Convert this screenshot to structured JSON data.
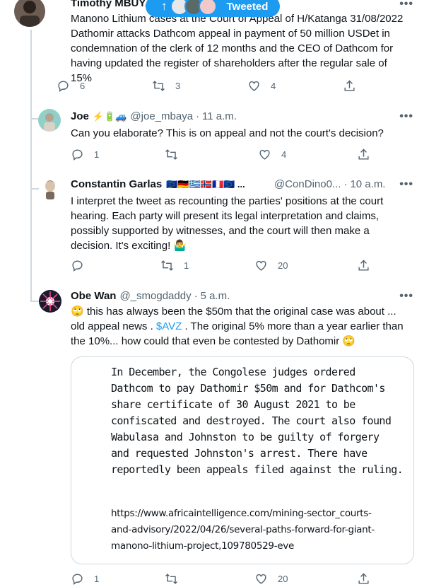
{
  "toast": {
    "label": "Tweeted",
    "arrow": "↑"
  },
  "tweets": [
    {
      "name": "Timothy MBUYA",
      "handle": "@",
      "text": "Manono Lithium cases at the Court of Appeal of H/Katanga 31/08/2022\nDathomir attacks Dathcom appeal in payment of 50 million USDet in\ncondemnation of the clerk of 12 months and the CEO of Dathcom for\nhaving updated the register of shareholders after the regular sale of 15%",
      "replies": "6",
      "retweets": "3",
      "likes": "4"
    },
    {
      "name": "Joe",
      "name_emoji": "⚡🔋🚙",
      "handle": "@joe_mbaya",
      "sep": "·",
      "time": "11 a.m.",
      "text": "Can you elaborate? This is on appeal and not the court's decision?",
      "replies": "1",
      "retweets": "",
      "likes": "4"
    },
    {
      "name": "Constantin Garlas",
      "name_flags": "🇪🇺🇩🇪🇬🇷🇳🇴🇫🇷🇪🇺 ...",
      "handle": "@ConDino0...",
      "sep": "·",
      "time": "10 a.m.",
      "text": "I interpret the tweet as recounting the parties' positions at the court\nhearing. Each party will present its legal interpretation and claims,\npossibly supported by witnesses, and the court will then make a\ndecision. It's exciting! 🤷‍♂️",
      "replies": "",
      "retweets": "1",
      "likes": "20"
    },
    {
      "name": "Obe Wan",
      "handle": "@_smogdaddy",
      "sep": "·",
      "time": "5 a.m.",
      "text_a": "🙄 this has always been the $50m that the original case was about ...\nold appeal news . ",
      "cashtag": "$AVZ",
      "text_b": " . The original 5% more than a year earlier than\nthe 10%... how could that even be contested by Dathomir 🙄",
      "quote_text": "In December, the Congolese judges ordered\nDathcom to pay Dathomir $50m and for Dathcom's\nshare certificate of 30 August 2021 to be\nconfiscated and destroyed. The court also found\nWabulasa and Johnston to be guilty of forgery\nand requested Johnston's arrest. There have\nreportedly been appeals filed against the ruling.",
      "quote_url": "https://www.africaintelligence.com/mining-sector_courts-\nand-advisory/2022/04/26/several-paths-forward-for-giant-\nmanono-lithium-project,109780529-eve",
      "replies": "1",
      "retweets": "",
      "likes": "20"
    }
  ],
  "more_glyph": "•••",
  "colors": {
    "accent": "#1d9bf0",
    "muted": "#536471",
    "line": "#cfd9de"
  }
}
